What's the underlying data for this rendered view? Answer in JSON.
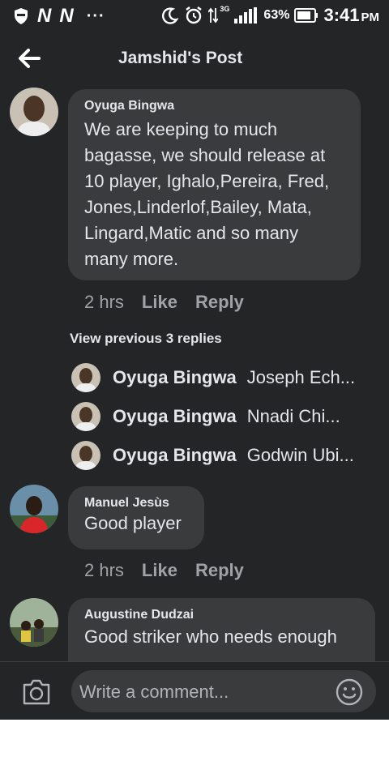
{
  "status_bar": {
    "battery_percent": "63%",
    "network": "3G",
    "time": "3:41",
    "ampm": "PM"
  },
  "header": {
    "title": "Jamshid's Post"
  },
  "comments": [
    {
      "author": "Oyuga Bingwa",
      "text": "We are keeping to much bagasse, we should release at 10 player, Ighalo,Pereira, Fred, Jones,Linderlof,Bailey, Mata, Lingard,Matic and so many many more.",
      "time": "2 hrs",
      "like": "Like",
      "reply": "Reply"
    },
    {
      "author": "Manuel Jesùs",
      "text": "Good player",
      "time": "2 hrs",
      "like": "Like",
      "reply": "Reply"
    },
    {
      "author": "Augustine Dudzai",
      "text": "Good striker who needs enough"
    }
  ],
  "replies": {
    "view_previous": "View previous 3 replies",
    "items": [
      {
        "name": "Oyuga Bingwa",
        "text": "Joseph Ech..."
      },
      {
        "name": "Oyuga Bingwa",
        "text": "Nnadi Chi..."
      },
      {
        "name": "Oyuga Bingwa",
        "text": "Godwin Ubi..."
      }
    ]
  },
  "composer": {
    "placeholder": "Write a comment..."
  },
  "colors": {
    "background": "#242526",
    "bubble": "#3a3b3c",
    "text": "#e4e6eb",
    "meta": "#a0a2a6"
  }
}
